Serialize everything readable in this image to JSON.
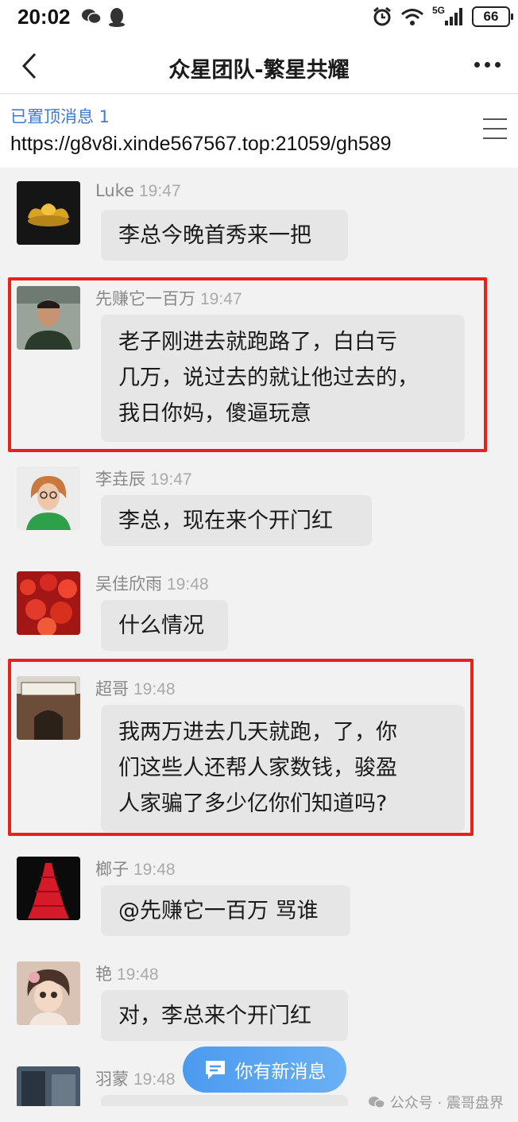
{
  "status_bar": {
    "time": "20:02",
    "battery": "66",
    "network": "5G",
    "icons": [
      "wechat-icon",
      "qq-icon",
      "alarm-icon",
      "wifi-icon",
      "signal-icon",
      "battery-icon"
    ]
  },
  "nav": {
    "title": "众星团队-繁星共耀",
    "back_icon": "chevron-left-icon",
    "more_icon": "more-dots-icon"
  },
  "pinned": {
    "label": "已置顶消息 1",
    "text": "https://g8v8i.xinde567567.top:21059/gh589",
    "menu_icon": "hamburger-icon"
  },
  "messages": [
    {
      "name": "Luke",
      "time": "19:47",
      "lines": [
        "李总今晚首秀来一把"
      ],
      "highlighted": false
    },
    {
      "name": "先赚它一百万",
      "time": "19:47",
      "lines": [
        "老子刚进去就跑路了，白白亏",
        "几万，说过去的就让他过去的，",
        "我日你妈，傻逼玩意"
      ],
      "highlighted": true
    },
    {
      "name": "李垚辰",
      "time": "19:47",
      "lines": [
        "李总，现在来个开门红"
      ],
      "highlighted": false
    },
    {
      "name": "吴佳欣雨",
      "time": "19:48",
      "lines": [
        "什么情况"
      ],
      "highlighted": false
    },
    {
      "name": "超哥",
      "time": "19:48",
      "lines": [
        "我两万进去几天就跑，了，你",
        "们这些人还帮人家数钱，骏盈",
        "人家骗了多少亿你们知道吗?"
      ],
      "highlighted": true
    },
    {
      "name": "榔子",
      "time": "19:48",
      "lines": [
        "@先赚它一百万 骂谁"
      ],
      "highlighted": false
    },
    {
      "name": "艳",
      "time": "19:48",
      "lines": [
        "对，李总来个开门红"
      ],
      "highlighted": false
    },
    {
      "name": "羽蒙",
      "time": "19:48",
      "lines": [
        ""
      ],
      "highlighted": false
    }
  ],
  "new_message_button": {
    "label": "你有新消息",
    "icon": "chat-bubble-icon"
  },
  "watermark": {
    "text": "公众号 · 震哥盘界",
    "icon": "wechat-icon"
  },
  "colors": {
    "highlight": "#e8221a",
    "pinned_label": "#3d7bd6",
    "bubble": "#e6e6e6",
    "new_message": "#4c9af0"
  }
}
